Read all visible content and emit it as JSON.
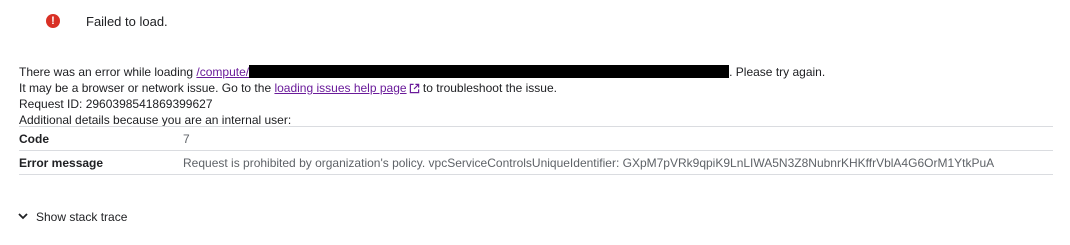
{
  "banner": {
    "title": "Failed to load.",
    "icon": "error-icon",
    "icon_color": "#d93025"
  },
  "message": {
    "line1_prefix": "There was an error while loading ",
    "line1_link": "/compute/",
    "line1_suffix": ". Please try again.",
    "line2_prefix": "It may be a browser or network issue. Go to the ",
    "line2_link": "loading issues help page",
    "line2_suffix": " to troubleshoot the issue.",
    "request_id": "Request ID: 2960398541869399627",
    "additional": "Additional details because you are an internal user:"
  },
  "details": [
    {
      "key": "Code",
      "value": "7"
    },
    {
      "key": "Error message",
      "value": "Request is prohibited by organization's policy. vpcServiceControlsUniqueIdentifier: GXpM7pVRk9qpiK9LnLIWA5N3Z8NubnrKHKffrVblA4G6OrM1YtkPuA"
    }
  ],
  "stack_trace": {
    "label": "Show stack trace",
    "icon": "chevron-down-icon"
  },
  "colors": {
    "link": "#6a1b9a",
    "divider": "#dadce0",
    "muted_text": "#5f6368"
  }
}
